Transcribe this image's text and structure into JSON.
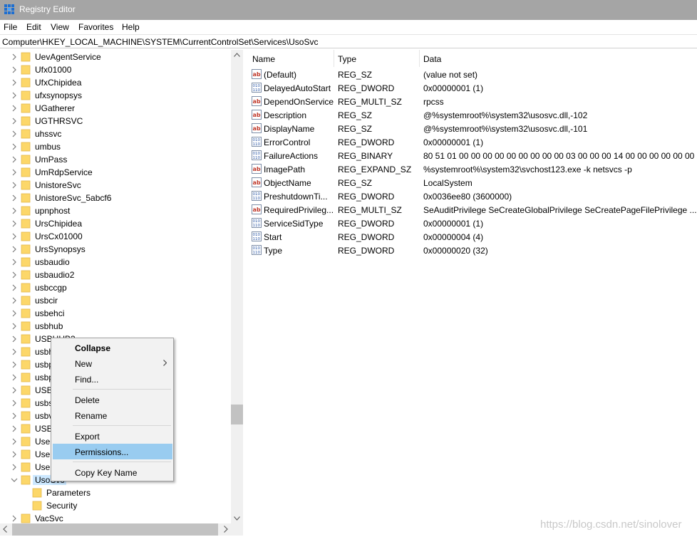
{
  "window": {
    "title": "Registry Editor",
    "icon": "registry-icon"
  },
  "menubar": [
    "File",
    "Edit",
    "View",
    "Favorites",
    "Help"
  ],
  "address": "Computer\\HKEY_LOCAL_MACHINE\\SYSTEM\\CurrentControlSet\\Services\\UsoSvc",
  "tree": [
    {
      "label": "UevAgentService",
      "expander": "chevron-right"
    },
    {
      "label": "Ufx01000",
      "expander": "chevron-right"
    },
    {
      "label": "UfxChipidea",
      "expander": "chevron-right"
    },
    {
      "label": "ufxsynopsys",
      "expander": "chevron-right"
    },
    {
      "label": "UGatherer",
      "expander": "chevron-right"
    },
    {
      "label": "UGTHRSVC",
      "expander": "chevron-right"
    },
    {
      "label": "uhssvc",
      "expander": "chevron-right"
    },
    {
      "label": "umbus",
      "expander": "chevron-right"
    },
    {
      "label": "UmPass",
      "expander": "chevron-right"
    },
    {
      "label": "UmRdpService",
      "expander": "chevron-right"
    },
    {
      "label": "UnistoreSvc",
      "expander": "chevron-right"
    },
    {
      "label": "UnistoreSvc_5abcf6",
      "expander": "chevron-right"
    },
    {
      "label": "upnphost",
      "expander": "chevron-right"
    },
    {
      "label": "UrsChipidea",
      "expander": "chevron-right"
    },
    {
      "label": "UrsCx01000",
      "expander": "chevron-right"
    },
    {
      "label": "UrsSynopsys",
      "expander": "chevron-right"
    },
    {
      "label": "usbaudio",
      "expander": "chevron-right"
    },
    {
      "label": "usbaudio2",
      "expander": "chevron-right"
    },
    {
      "label": "usbccgp",
      "expander": "chevron-right"
    },
    {
      "label": "usbcir",
      "expander": "chevron-right"
    },
    {
      "label": "usbehci",
      "expander": "chevron-right"
    },
    {
      "label": "usbhub",
      "expander": "chevron-right"
    },
    {
      "label": "USBHUB3",
      "expander": "chevron-right"
    },
    {
      "label": "usbh",
      "expander": "chevron-right"
    },
    {
      "label": "usbp",
      "expander": "chevron-right"
    },
    {
      "label": "usbp",
      "expander": "chevron-right"
    },
    {
      "label": "USBS",
      "expander": "chevron-right"
    },
    {
      "label": "usbs",
      "expander": "chevron-right"
    },
    {
      "label": "usbv",
      "expander": "chevron-right"
    },
    {
      "label": "USBX",
      "expander": "chevron-right"
    },
    {
      "label": "User",
      "expander": "chevron-right"
    },
    {
      "label": "User",
      "expander": "chevron-right"
    },
    {
      "label": "User",
      "expander": "chevron-right"
    },
    {
      "label": "UsoSvc",
      "expander": "chevron-down",
      "selected": true
    },
    {
      "label": "Parameters",
      "expander": "none",
      "child": true
    },
    {
      "label": "Security",
      "expander": "none",
      "child": true
    },
    {
      "label": "VacSvc",
      "expander": "chevron-right"
    }
  ],
  "columns": {
    "name": "Name",
    "type": "Type",
    "data": "Data"
  },
  "values": [
    {
      "name": "(Default)",
      "type": "REG_SZ",
      "data": "(value not set)",
      "icon": "string-value-icon"
    },
    {
      "name": "DelayedAutoStart",
      "type": "REG_DWORD",
      "data": "0x00000001 (1)",
      "icon": "binary-value-icon"
    },
    {
      "name": "DependOnService",
      "type": "REG_MULTI_SZ",
      "data": "rpcss",
      "icon": "string-value-icon"
    },
    {
      "name": "Description",
      "type": "REG_SZ",
      "data": "@%systemroot%\\system32\\usosvc.dll,-102",
      "icon": "string-value-icon"
    },
    {
      "name": "DisplayName",
      "type": "REG_SZ",
      "data": "@%systemroot%\\system32\\usosvc.dll,-101",
      "icon": "string-value-icon"
    },
    {
      "name": "ErrorControl",
      "type": "REG_DWORD",
      "data": "0x00000001 (1)",
      "icon": "binary-value-icon"
    },
    {
      "name": "FailureActions",
      "type": "REG_BINARY",
      "data": "80 51 01 00 00 00 00 00 00 00 00 00 03 00 00 00 14 00 00 00 00 00 00 0...",
      "icon": "binary-value-icon"
    },
    {
      "name": "ImagePath",
      "type": "REG_EXPAND_SZ",
      "data": "%systemroot%\\system32\\svchost123.exe -k netsvcs -p",
      "icon": "string-value-icon"
    },
    {
      "name": "ObjectName",
      "type": "REG_SZ",
      "data": "LocalSystem",
      "icon": "string-value-icon"
    },
    {
      "name": "PreshutdownTi...",
      "type": "REG_DWORD",
      "data": "0x0036ee80 (3600000)",
      "icon": "binary-value-icon"
    },
    {
      "name": "RequiredPrivileg...",
      "type": "REG_MULTI_SZ",
      "data": "SeAuditPrivilege SeCreateGlobalPrivilege SeCreatePageFilePrivilege ...",
      "icon": "string-value-icon"
    },
    {
      "name": "ServiceSidType",
      "type": "REG_DWORD",
      "data": "0x00000001 (1)",
      "icon": "binary-value-icon"
    },
    {
      "name": "Start",
      "type": "REG_DWORD",
      "data": "0x00000004 (4)",
      "icon": "binary-value-icon"
    },
    {
      "name": "Type",
      "type": "REG_DWORD",
      "data": "0x00000020 (32)",
      "icon": "binary-value-icon"
    }
  ],
  "context_menu": {
    "collapse": "Collapse",
    "new": "New",
    "find": "Find...",
    "delete": "Delete",
    "rename": "Rename",
    "export": "Export",
    "permissions": "Permissions...",
    "copy_key_name": "Copy Key Name"
  },
  "watermark": "https://blog.csdn.net/sinolover",
  "colors": {
    "titlebar": "#a5a5a5",
    "folder": "#fcd769",
    "selection": "#cce8ff",
    "menu_highlight": "#99ccf0"
  }
}
